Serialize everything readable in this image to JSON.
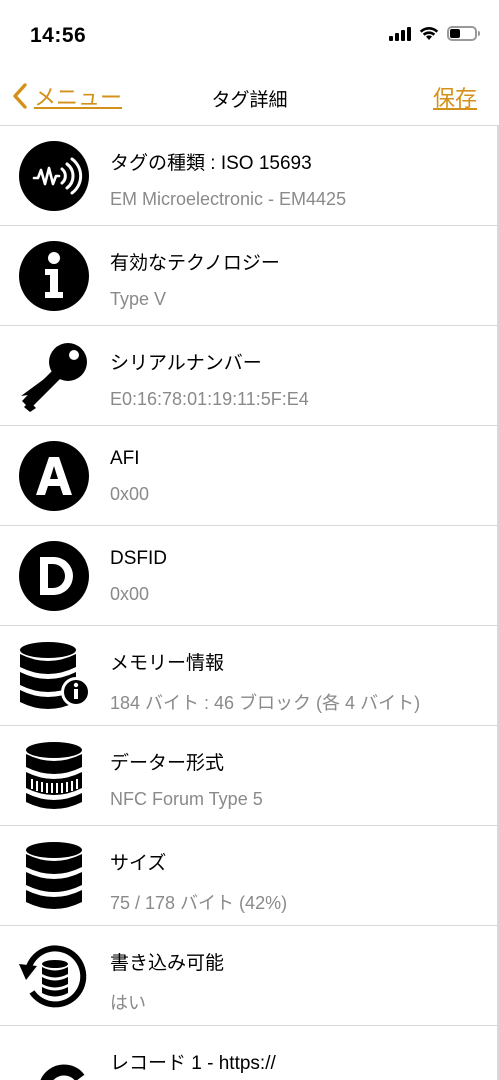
{
  "status": {
    "time": "14:56"
  },
  "nav": {
    "back_label": "メニュー",
    "title": "タグ詳細",
    "save_label": "保存"
  },
  "colors": {
    "accent": "#d4911a",
    "subtitle": "#8a8a8a",
    "separator": "#d8d8d8"
  },
  "rows": [
    {
      "icon": "nfc-wave-icon",
      "title": "タグの種類 : ISO 15693",
      "sub": "EM Microelectronic - EM4425"
    },
    {
      "icon": "info-icon",
      "title": "有効なテクノロジー",
      "sub": "Type V"
    },
    {
      "icon": "key-icon",
      "title": "シリアルナンバー",
      "sub": "E0:16:78:01:19:11:5F:E4"
    },
    {
      "icon": "letter-a-icon",
      "title": "AFI",
      "sub": "0x00"
    },
    {
      "icon": "letter-d-icon",
      "title": "DSFID",
      "sub": "0x00"
    },
    {
      "icon": "database-info-icon",
      "title": "メモリー情報",
      "sub": "184 バイト : 46 ブロック (各 4 バイト)"
    },
    {
      "icon": "database-barcode-icon",
      "title": "データー形式",
      "sub": "NFC Forum Type 5"
    },
    {
      "icon": "database-icon",
      "title": "サイズ",
      "sub": "75 / 178 バイト (42%)"
    },
    {
      "icon": "database-refresh-icon",
      "title": "書き込み可能",
      "sub": "はい"
    },
    {
      "icon": "link-icon",
      "title": "レコード 1 - https://",
      "sub": ""
    }
  ]
}
